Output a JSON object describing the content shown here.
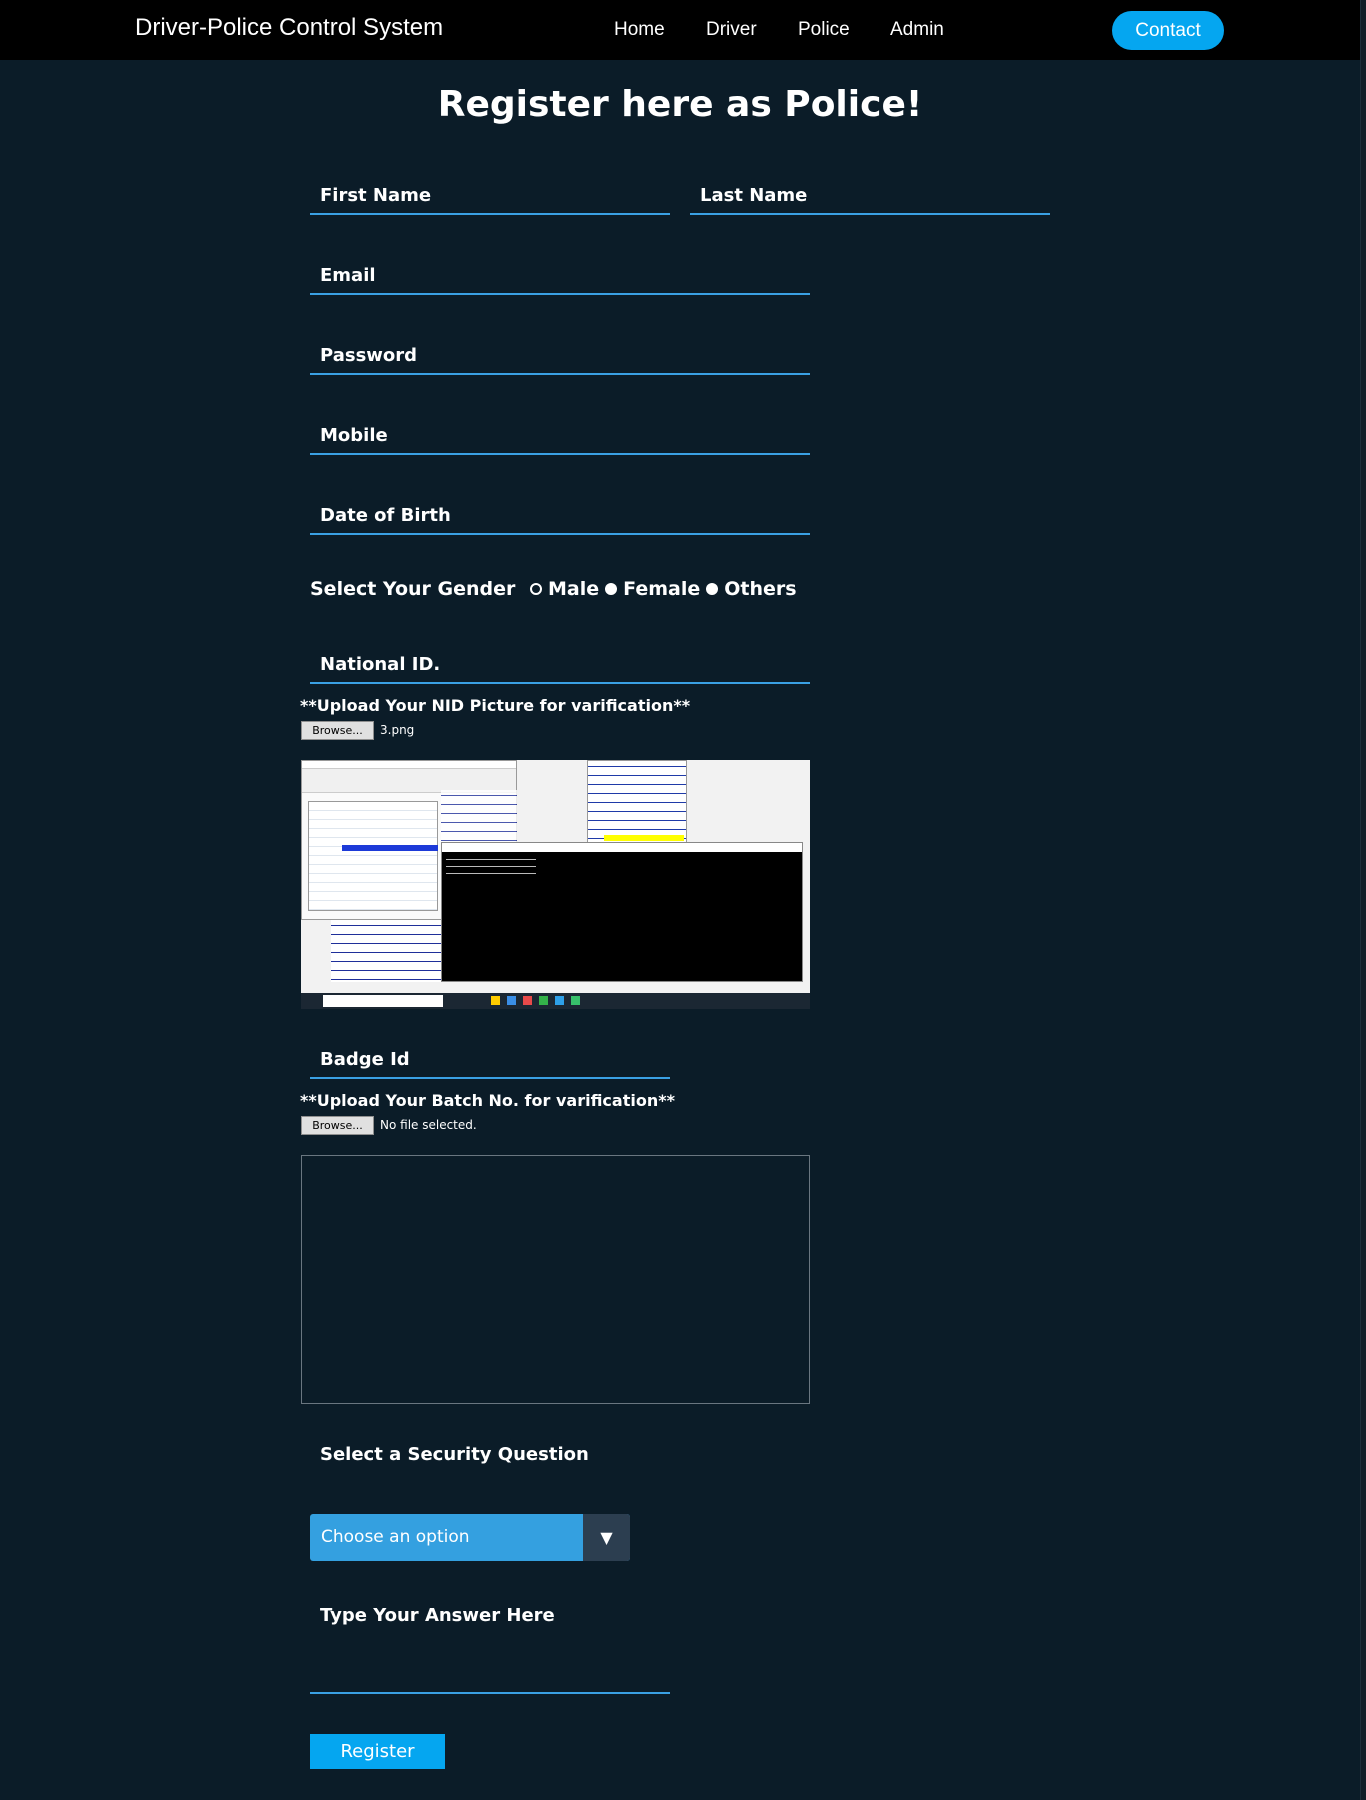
{
  "nav": {
    "brand": "Driver-Police Control System",
    "links": [
      "Home",
      "Driver",
      "Police",
      "Admin"
    ],
    "contact": "Contact"
  },
  "page": {
    "title": "Register here as Police!"
  },
  "form": {
    "first_name": "First Name",
    "last_name": "Last Name",
    "email": "Email",
    "password": "Password",
    "mobile": "Mobile",
    "dob": "Date of Birth",
    "gender_label": "Select Your Gender",
    "gender_options": [
      "Male",
      "Female",
      "Others"
    ],
    "nid": "National ID.",
    "nid_upload_note": "**Upload Your NID Picture for varification**",
    "nid_browse": "Browse...",
    "nid_file": "3.png",
    "badge": "Badge Id",
    "batch_upload_note": "**Upload Your Batch No. for varification**",
    "batch_browse": "Browse...",
    "batch_file": "No file selected.",
    "security_label": "Select a Security Question",
    "security_select": "Choose an option",
    "answer_label": "Type Your Answer Here",
    "register": "Register"
  },
  "colors": {
    "accent": "#05a6f0",
    "underline": "#3aa0e3",
    "background": "#0b1c28",
    "navbar": "#000000",
    "select_bg": "#34a0e0",
    "select_arrow_bg": "#2c3e50"
  }
}
